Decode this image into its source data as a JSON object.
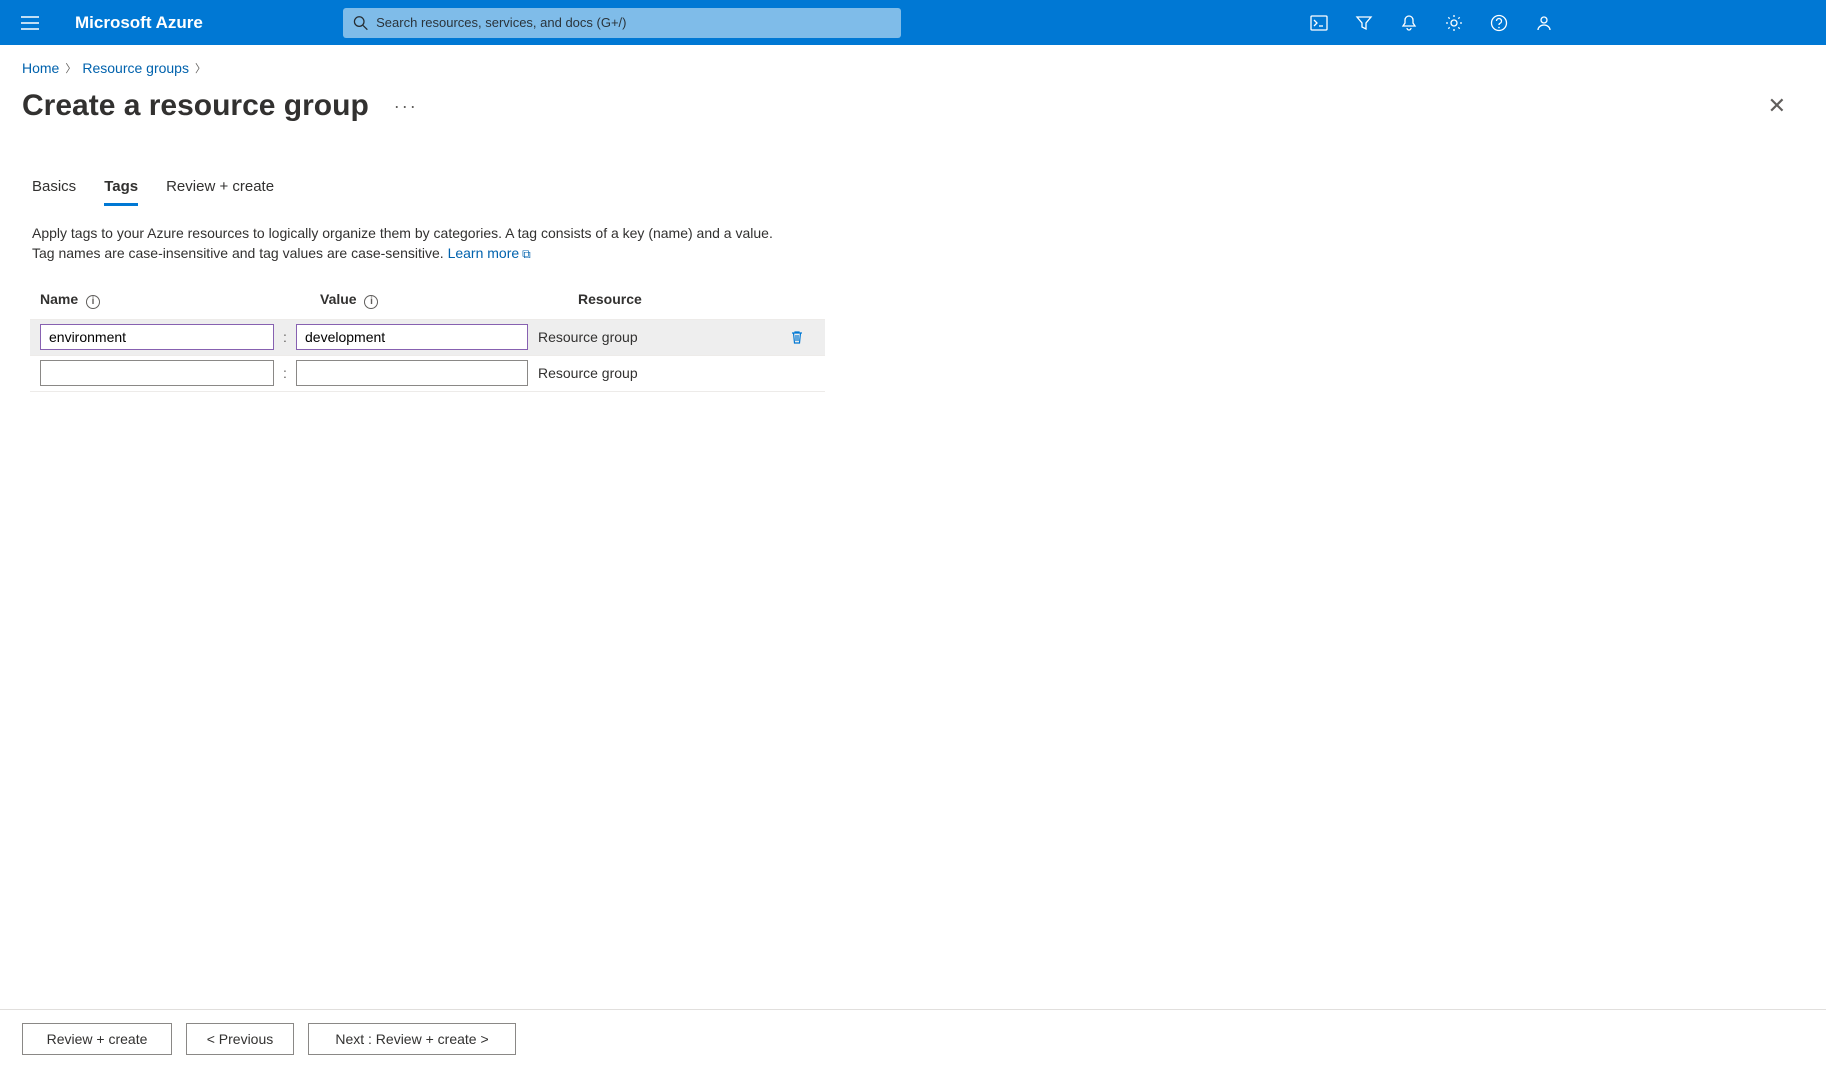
{
  "header": {
    "brand": "Microsoft Azure",
    "search_placeholder": "Search resources, services, and docs (G+/)"
  },
  "breadcrumb": {
    "home": "Home",
    "resource_groups": "Resource groups"
  },
  "blade": {
    "title": "Create a resource group"
  },
  "tabs": {
    "basics": "Basics",
    "tags": "Tags",
    "review": "Review + create"
  },
  "description": {
    "line": "Apply tags to your Azure resources to logically organize them by categories. A tag consists of a key (name) and a value. Tag names are case-insensitive and tag values are case-sensitive. ",
    "learn_more": "Learn more"
  },
  "table": {
    "col_name": "Name",
    "col_value": "Value",
    "col_resource": "Resource",
    "rows": [
      {
        "name": "environment",
        "value": "development",
        "resource": "Resource group",
        "filled": true
      },
      {
        "name": "",
        "value": "",
        "resource": "Resource group",
        "filled": false
      }
    ]
  },
  "footer": {
    "review": "Review + create",
    "previous": "< Previous",
    "next": "Next : Review + create >"
  }
}
